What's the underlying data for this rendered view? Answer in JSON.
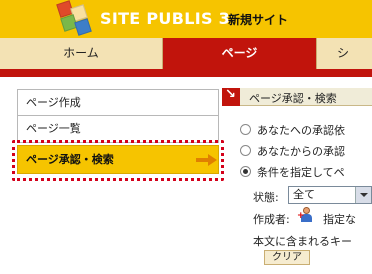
{
  "header": {
    "product": "SITE PUBLIS 3",
    "site_name": "新規サイト",
    "colors": {
      "header_bg": "#f6c400",
      "accent_red": "#c1140c"
    }
  },
  "tabs": [
    {
      "label": "ホーム",
      "active": false
    },
    {
      "label": "ページ",
      "active": true
    },
    {
      "label": "シ",
      "active": false
    }
  ],
  "sidebar": {
    "items": [
      {
        "label": "ページ作成"
      },
      {
        "label": "ページ一覧"
      },
      {
        "label": "ページ承認・検索",
        "active": true
      }
    ]
  },
  "panel": {
    "title": "ページ承認・検索",
    "radios": [
      {
        "label": "あなたへの承認依",
        "checked": false
      },
      {
        "label": "あなたからの承認",
        "checked": false
      },
      {
        "label": "条件を指定してペ",
        "checked": true
      }
    ],
    "status_label": "状態:",
    "status_value": "全て",
    "author_label": "作成者:",
    "author_value": "指定な",
    "body_search_label": "本文に含まれるキー",
    "clear_button": "クリア"
  }
}
